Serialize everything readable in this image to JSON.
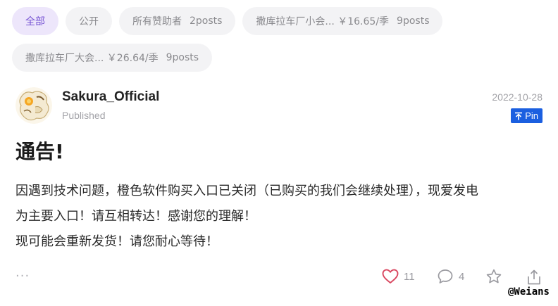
{
  "filter_tabs": [
    {
      "label": "全部",
      "count": "",
      "active": true
    },
    {
      "label": "公开",
      "count": "",
      "active": false
    },
    {
      "label": "所有赞助者",
      "count": "2posts",
      "active": false
    },
    {
      "label": "撒库拉车厂小会... ￥16.65/季",
      "count": "9posts",
      "active": false
    },
    {
      "label": "撒库拉车厂大会... ￥26.64/季",
      "count": "9posts",
      "active": false
    }
  ],
  "post": {
    "author": "Sakura_Official",
    "status": "Published",
    "date": "2022-10-28",
    "pin_label": "Pin",
    "title": "通告!",
    "body_lines": [
      "因遇到技术问题，橙色软件购买入口已关闭（已购买的我们会继续处理），现爱发电",
      "为主要入口！请互相转达！感谢您的理解！",
      "现可能会重新发货！请您耐心等待！"
    ],
    "more_label": "···",
    "likes": "11",
    "comments": "4"
  },
  "watermark": "@Weians",
  "colors": {
    "accent": "#7653d3",
    "tab_bg": "#f3f3f5",
    "tab_active_bg": "#ede6fb",
    "pin_bg": "#1b5fe0",
    "like_icon": "#d9465f"
  },
  "icons": {
    "pin": "pin-up-arrow-icon",
    "like": "heart-icon",
    "comment": "speech-bubble-icon",
    "favorite": "star-icon",
    "share": "share-icon",
    "more": "more-dots-icon"
  }
}
